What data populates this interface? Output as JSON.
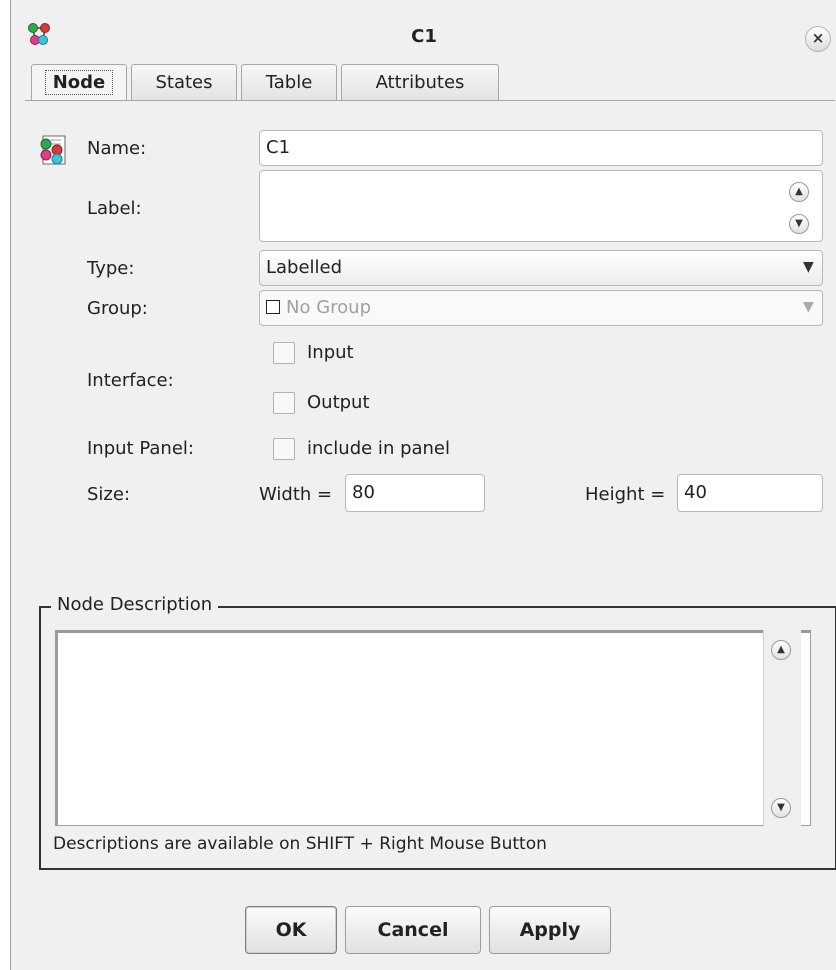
{
  "window": {
    "title": "C1",
    "close_icon": "×"
  },
  "tabs": [
    {
      "label": "Node",
      "active": true
    },
    {
      "label": "States",
      "active": false
    },
    {
      "label": "Table",
      "active": false
    },
    {
      "label": "Attributes",
      "active": false
    }
  ],
  "node": {
    "name_label": "Name:",
    "name_value": "C1",
    "label_label": "Label:",
    "label_value": "",
    "type_label": "Type:",
    "type_value": "Labelled",
    "group_label": "Group:",
    "group_value": "No Group",
    "interface_label": "Interface:",
    "input_label": "Input",
    "input_checked": false,
    "output_label": "Output",
    "output_checked": false,
    "input_panel_label": "Input Panel:",
    "include_label": "include in panel",
    "include_checked": false,
    "size_label": "Size:",
    "width_label": "Width =",
    "width_value": "80",
    "height_label": "Height =",
    "height_value": "40"
  },
  "description": {
    "legend": "Node Description",
    "value": "",
    "hint": "Descriptions are available on SHIFT + Right Mouse Button"
  },
  "buttons": {
    "ok": "OK",
    "cancel": "Cancel",
    "apply": "Apply"
  },
  "icons": {
    "app": "network-nodes-icon",
    "node": "node-properties-icon",
    "scroll_up": "scroll-up-icon",
    "scroll_down": "scroll-down-icon",
    "dropdown": "chevron-down-icon"
  }
}
